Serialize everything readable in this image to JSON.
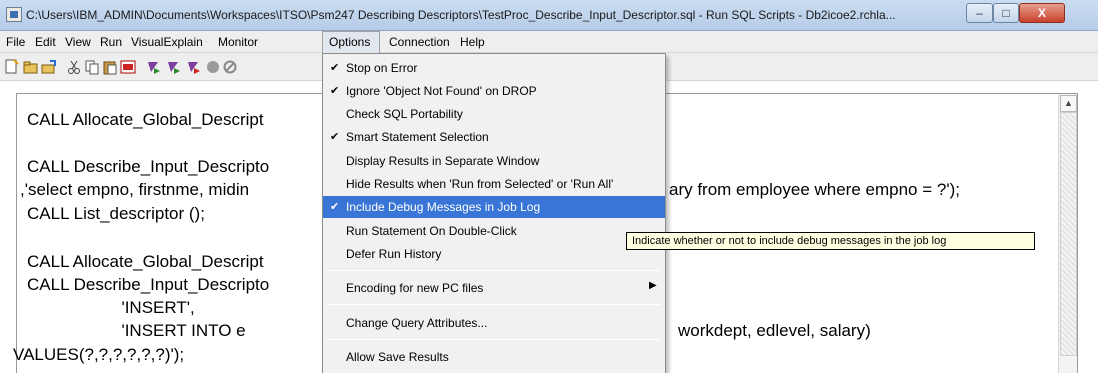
{
  "window": {
    "title": "C:\\Users\\IBM_ADMIN\\Documents\\Workspaces\\ITSO\\Psm247 Describing Descriptors\\TestProc_Describe_Input_Descriptor.sql - Run SQL Scripts - Db2icoe2.rchla...",
    "minimize_label": "–",
    "maximize_label": "□",
    "close_label": "X"
  },
  "menubar": {
    "items": [
      "File",
      "Edit",
      "View",
      "Run",
      "VisualExplain",
      "Monitor",
      "Options",
      "Connection",
      "Help"
    ]
  },
  "toolbar": {
    "icons": [
      "new-script-icon",
      "open-icon",
      "save-icon",
      "cut-icon",
      "copy-icon",
      "paste-icon",
      "find-icon",
      "run-all-icon",
      "run-from-selected-icon",
      "run-selected-icon",
      "stop-icon",
      "cancel-icon"
    ]
  },
  "editor": {
    "lines": [
      "CALL Allocate_Global_Descript",
      "CALL Describe_Input_Descripto",
      ",'select empno, firstnme, midin",
      "ary from employee where empno = ?');",
      "CALL List_descriptor ();",
      "CALL Allocate_Global_Descript",
      "CALL Describe_Input_Descripto",
      "                    'INSERT',",
      "                    'INSERT INTO e",
      "workdept, edlevel, salary)",
      "VALUES(?,?,?,?,?,?)');"
    ]
  },
  "options_menu": {
    "items": [
      {
        "label": "Stop on Error",
        "checked": true
      },
      {
        "label": "Ignore 'Object Not Found' on DROP",
        "checked": true
      },
      {
        "label": "Check SQL Portability",
        "checked": false
      },
      {
        "label": "Smart Statement Selection",
        "checked": true
      },
      {
        "label": "Display Results in Separate Window",
        "checked": false
      },
      {
        "label": "Hide Results when 'Run from Selected' or 'Run All'",
        "checked": false
      },
      {
        "label": "Include Debug Messages in Job Log",
        "checked": true,
        "highlighted": true
      },
      {
        "label": "Run Statement On Double-Click",
        "checked": false
      },
      {
        "label": "Defer Run History",
        "checked": false
      },
      {
        "label": "Encoding for new PC files",
        "checked": false,
        "submenu": true
      },
      {
        "label": "Change Query Attributes...",
        "checked": false
      },
      {
        "label": "Allow Save Results",
        "checked": false
      }
    ],
    "check_glyph": "✔",
    "submenu_glyph": "▶"
  },
  "tooltip": {
    "text": "Indicate whether or not to include debug messages in the job log"
  },
  "colors": {
    "highlight": "#3875d7",
    "tooltip_bg": "#ffffe1",
    "menu_bg": "#f1f1f1"
  }
}
